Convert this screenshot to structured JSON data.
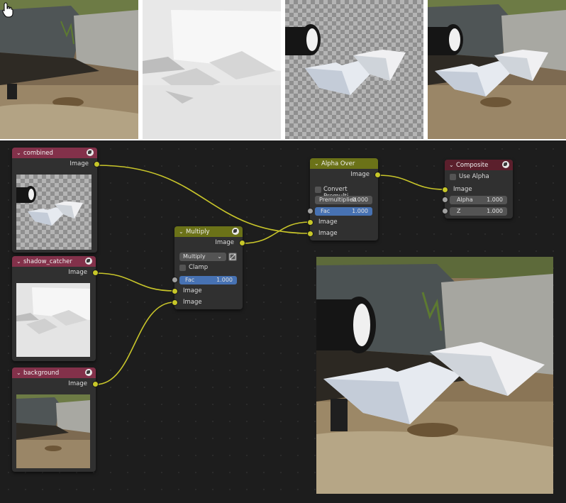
{
  "nodes": {
    "combined": {
      "title": "combined",
      "output": "Image"
    },
    "shadow_catcher": {
      "title": "shadow_catcher",
      "output": "Image"
    },
    "background": {
      "title": "background",
      "output": "Image"
    },
    "multiply": {
      "title": "Multiply",
      "output": "Image",
      "blend_type": "Multiply",
      "clamp_label": "Clamp",
      "fac_label": "Fac",
      "fac_value": "1.000",
      "input1": "Image",
      "input2": "Image"
    },
    "alpha_over": {
      "title": "Alpha Over",
      "output": "Image",
      "convert_label": "Convert Premulti...",
      "premultiplied_label": "Premultiplied",
      "premultiplied_value": "0.000",
      "fac_label": "Fac",
      "fac_value": "1.000",
      "input1": "Image",
      "input2": "Image"
    },
    "composite": {
      "title": "Composite",
      "use_alpha_label": "Use Alpha",
      "input_image": "Image",
      "alpha_label": "Alpha",
      "alpha_value": "1.000",
      "z_label": "Z",
      "z_value": "1.000"
    }
  },
  "colors": {
    "image_header": "#83314a",
    "color_header": "#6b7218",
    "output_header": "#5b1f2c",
    "socket_image": "#c7c729",
    "socket_value": "#a1a1a1",
    "wire": "#c8c52a",
    "field_active": "#4772b3",
    "editor_bg": "#1d1d1d"
  },
  "icons": {
    "node_header": "sphere-preview-icon",
    "dropdown": "chevron-down-icon",
    "cursor": "hand-pointer-icon"
  }
}
